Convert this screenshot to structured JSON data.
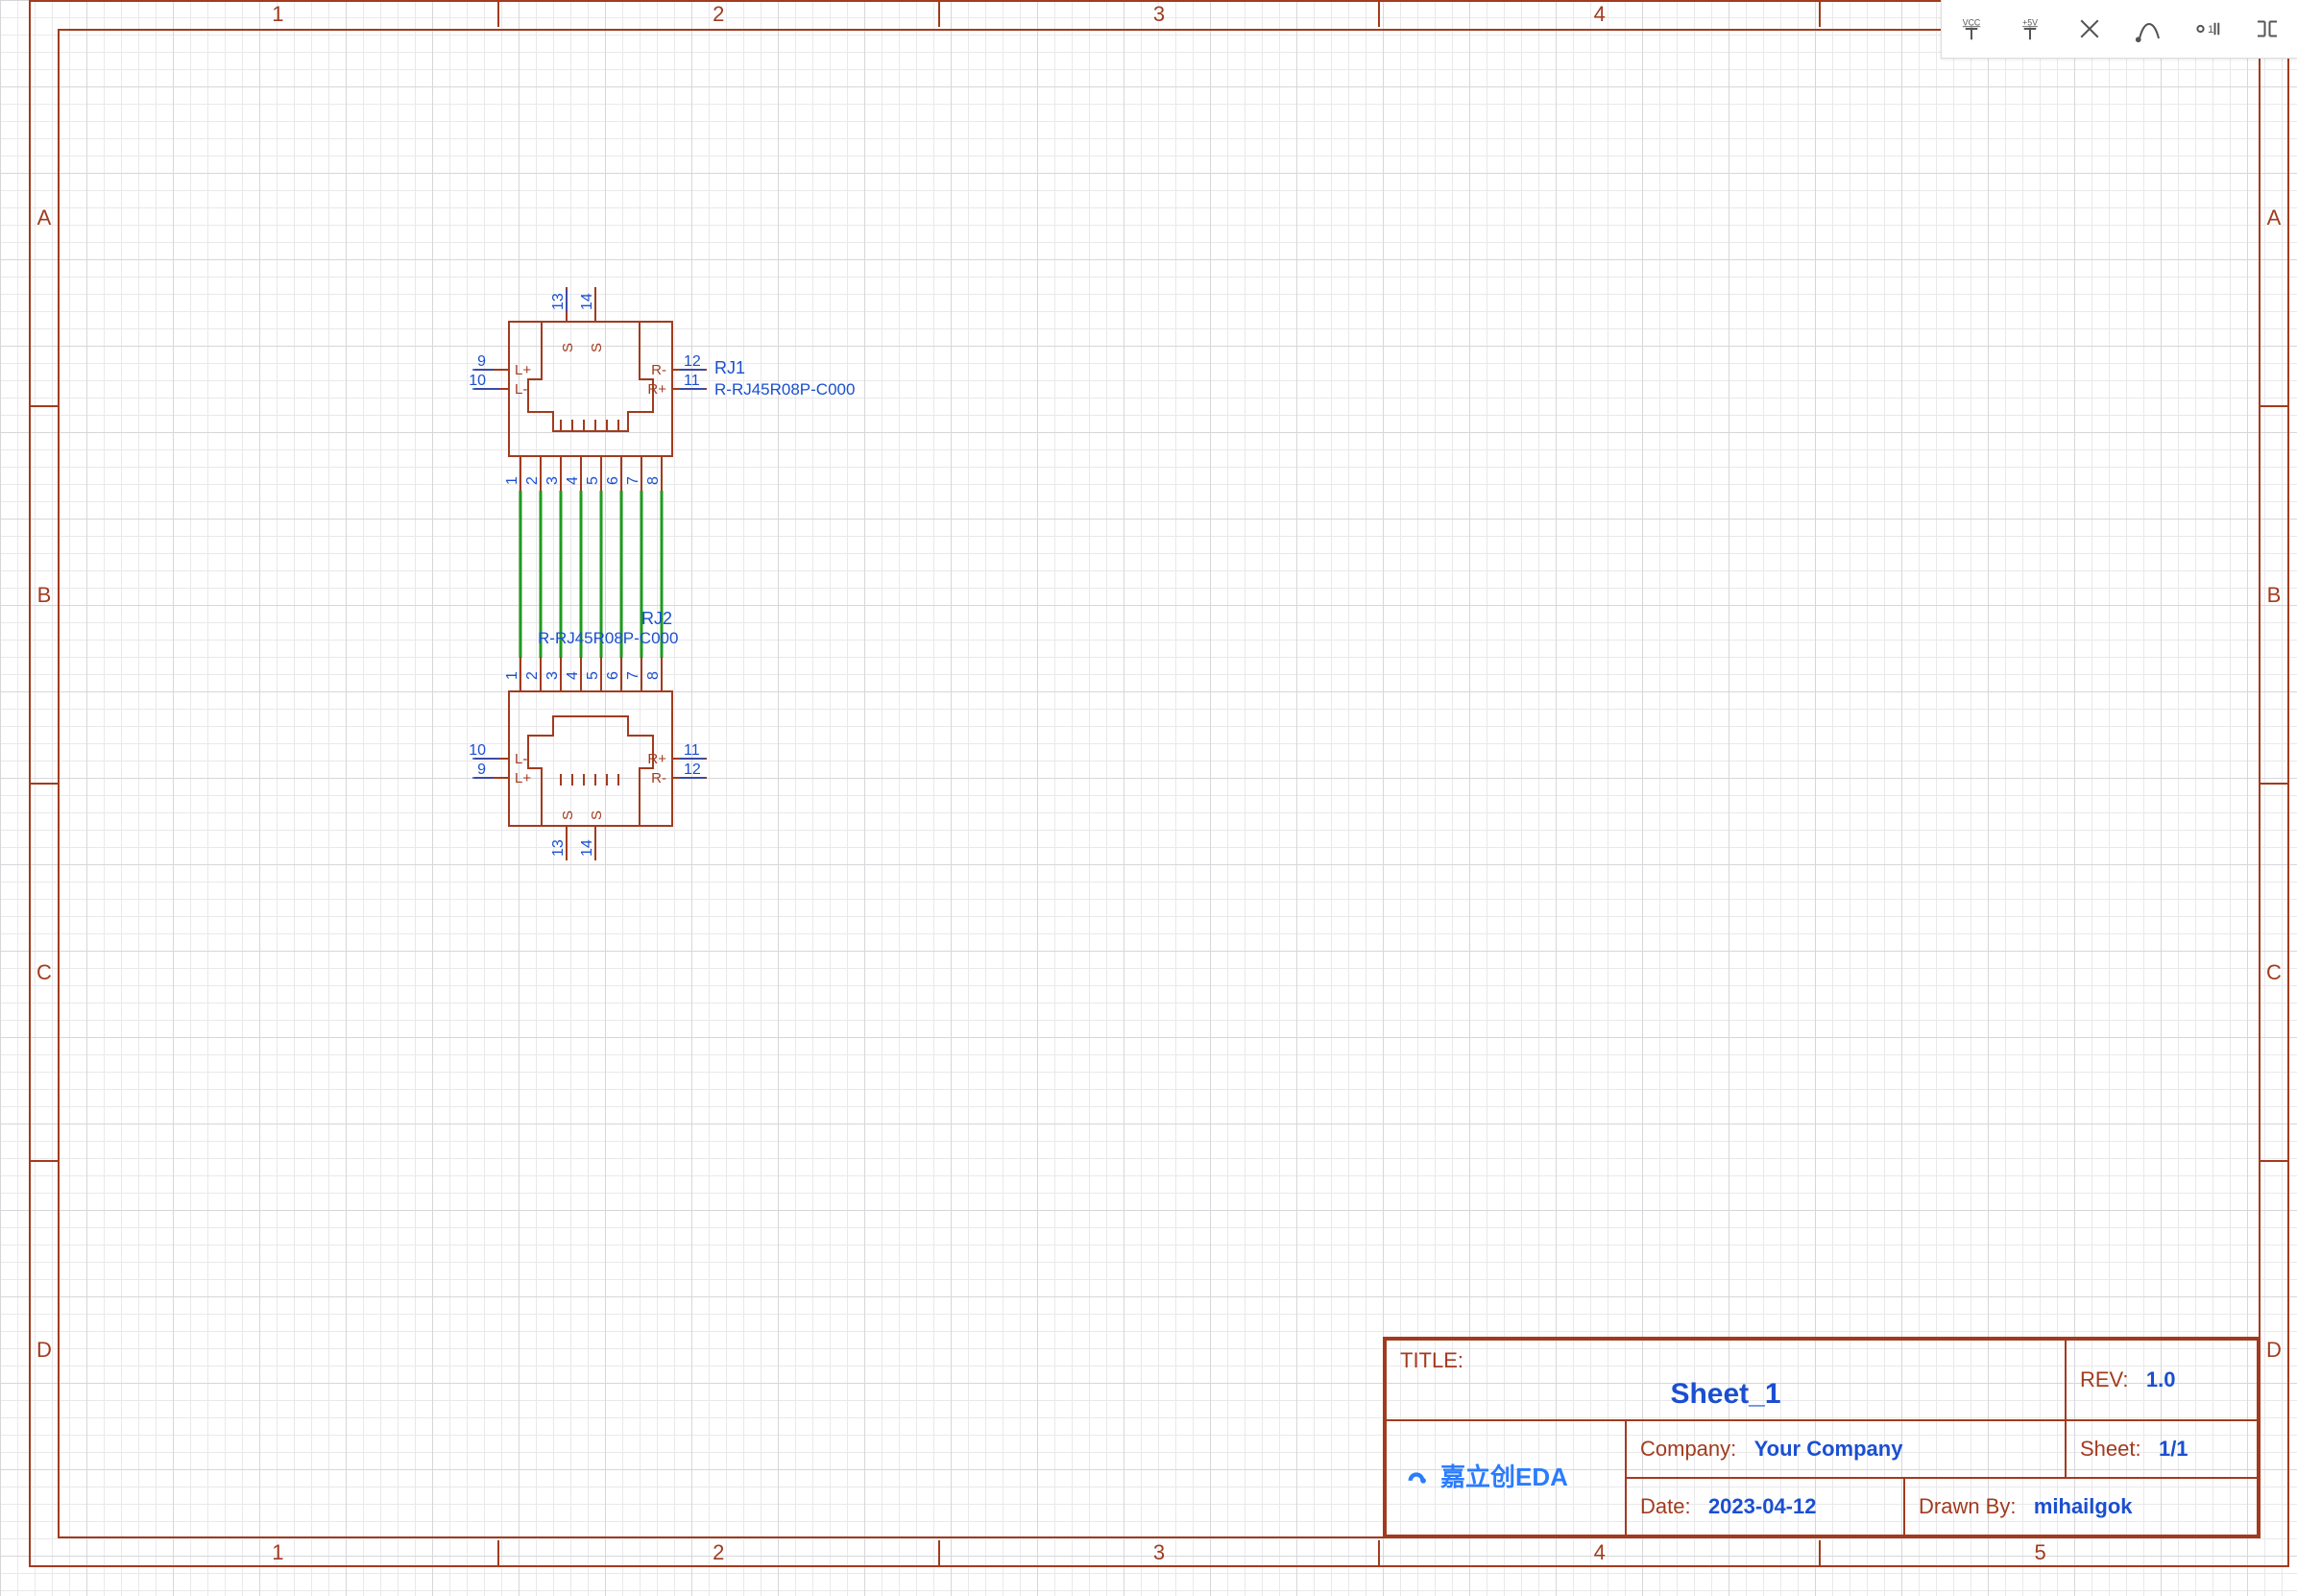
{
  "frame": {
    "columns": [
      "1",
      "2",
      "3",
      "4",
      "5"
    ],
    "rows": [
      "A",
      "B",
      "C",
      "D"
    ]
  },
  "title_block": {
    "title_label": "TITLE:",
    "title_value": "Sheet_1",
    "rev_label": "REV:",
    "rev_value": "1.0",
    "company_label": "Company:",
    "company_value": "Your Company",
    "sheet_label": "Sheet:",
    "sheet_value": "1/1",
    "date_label": "Date:",
    "date_value": "2023-04-12",
    "drawn_label": "Drawn By:",
    "drawn_value": "mihailgok",
    "logo_text": "嘉立创EDA"
  },
  "toolbar": {
    "vcc": "VCC",
    "plus5v": "+5V",
    "nc": "×",
    "xtal": "⌇",
    "flag": "⚐",
    "bus": "⇄"
  },
  "components": {
    "rj1": {
      "ref": "RJ1",
      "part": "R-RJ45R08P-C000",
      "bottom_pins": [
        "1",
        "2",
        "3",
        "4",
        "5",
        "6",
        "7",
        "8"
      ],
      "left_pins": [
        [
          "9",
          "L+"
        ],
        [
          "10",
          "L-"
        ]
      ],
      "right_pins": [
        [
          "12",
          "R-"
        ],
        [
          "11",
          "R+"
        ]
      ],
      "top_pins": [
        [
          "13",
          "S"
        ],
        [
          "14",
          "S"
        ]
      ]
    },
    "rj2": {
      "ref": "RJ2",
      "part": "R-RJ45R08P-C000",
      "top_pins": [
        "1",
        "2",
        "3",
        "4",
        "5",
        "6",
        "7",
        "8"
      ],
      "left_pins": [
        [
          "10",
          "L-"
        ],
        [
          "9",
          "L+"
        ]
      ],
      "right_pins": [
        [
          "11",
          "R+"
        ],
        [
          "12",
          "R-"
        ]
      ],
      "bottom_pins": [
        [
          "13",
          "S"
        ],
        [
          "14",
          "S"
        ]
      ]
    }
  }
}
